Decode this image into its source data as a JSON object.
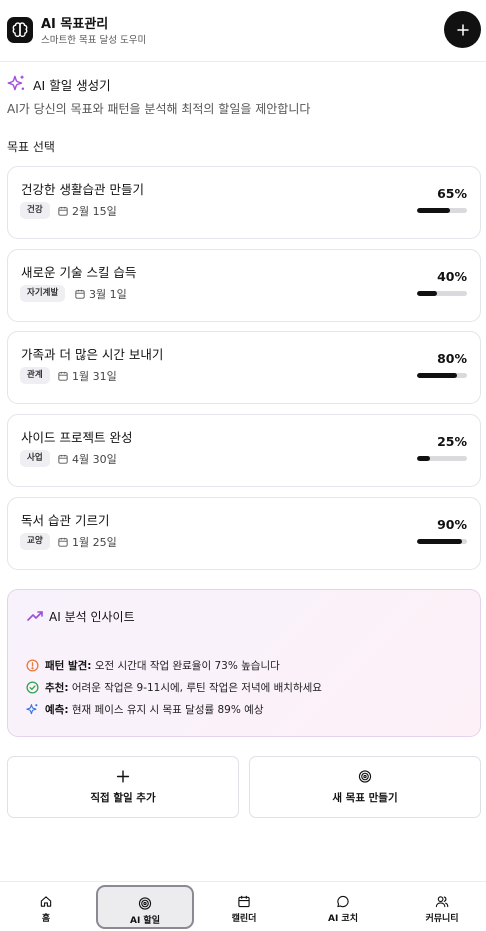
{
  "header": {
    "title": "AI 목표관리",
    "subtitle": "스마트한 목표 달성 도우미"
  },
  "generator": {
    "title": "AI 할일 생성기",
    "description": "AI가 당신의 목표와 패턴을 분석해 최적의 할일을 제안합니다"
  },
  "goals_section_label": "목표 선택",
  "goals": [
    {
      "title": "건강한 생활습관 만들기",
      "tag": "건강",
      "date": "2월 15일",
      "percent_label": "65%",
      "progress": 0.65
    },
    {
      "title": "새로운 기술 스킬 습득",
      "tag": "자기계발",
      "date": "3월 1일",
      "percent_label": "40%",
      "progress": 0.4
    },
    {
      "title": "가족과 더 많은 시간 보내기",
      "tag": "관계",
      "date": "1월 31일",
      "percent_label": "80%",
      "progress": 0.8
    },
    {
      "title": "사이드 프로젝트 완성",
      "tag": "사업",
      "date": "4월 30일",
      "percent_label": "25%",
      "progress": 0.25
    },
    {
      "title": "독서 습관 기르기",
      "tag": "교양",
      "date": "1월 25일",
      "percent_label": "90%",
      "progress": 0.9
    }
  ],
  "insights": {
    "title": "AI 분석 인사이트",
    "items": [
      {
        "icon": "alert-circle-icon",
        "color": "#e8793a",
        "label": "패턴 발견:",
        "text": "오전 시간대 작업 완료율이 73% 높습니다"
      },
      {
        "icon": "check-circle-icon",
        "color": "#2ea44f",
        "label": "추천:",
        "text": "어려운 작업은 9-11시에, 루틴 작업은 저녁에 배치하세요"
      },
      {
        "icon": "sparkles-icon",
        "color": "#3b6fe0",
        "label": "예측:",
        "text": "현재 페이스 유지 시 목표 달성률 89% 예상"
      }
    ]
  },
  "actions": {
    "add_task": "직접 할일 추가",
    "new_goal": "새 목표 만들기"
  },
  "nav": [
    {
      "icon": "home-icon",
      "label": "홈",
      "active": false
    },
    {
      "icon": "target-icon",
      "label": "AI 할일",
      "active": true
    },
    {
      "icon": "calendar-icon",
      "label": "캘린더",
      "active": false
    },
    {
      "icon": "chat-icon",
      "label": "AI 코치",
      "active": false
    },
    {
      "icon": "users-icon",
      "label": "커뮤니티",
      "active": false
    }
  ],
  "colors": {
    "accent_purple": "#a44de0",
    "trend_purple": "#9b4fd6",
    "progress_fill": "#111111",
    "progress_track": "#d9d9de"
  }
}
